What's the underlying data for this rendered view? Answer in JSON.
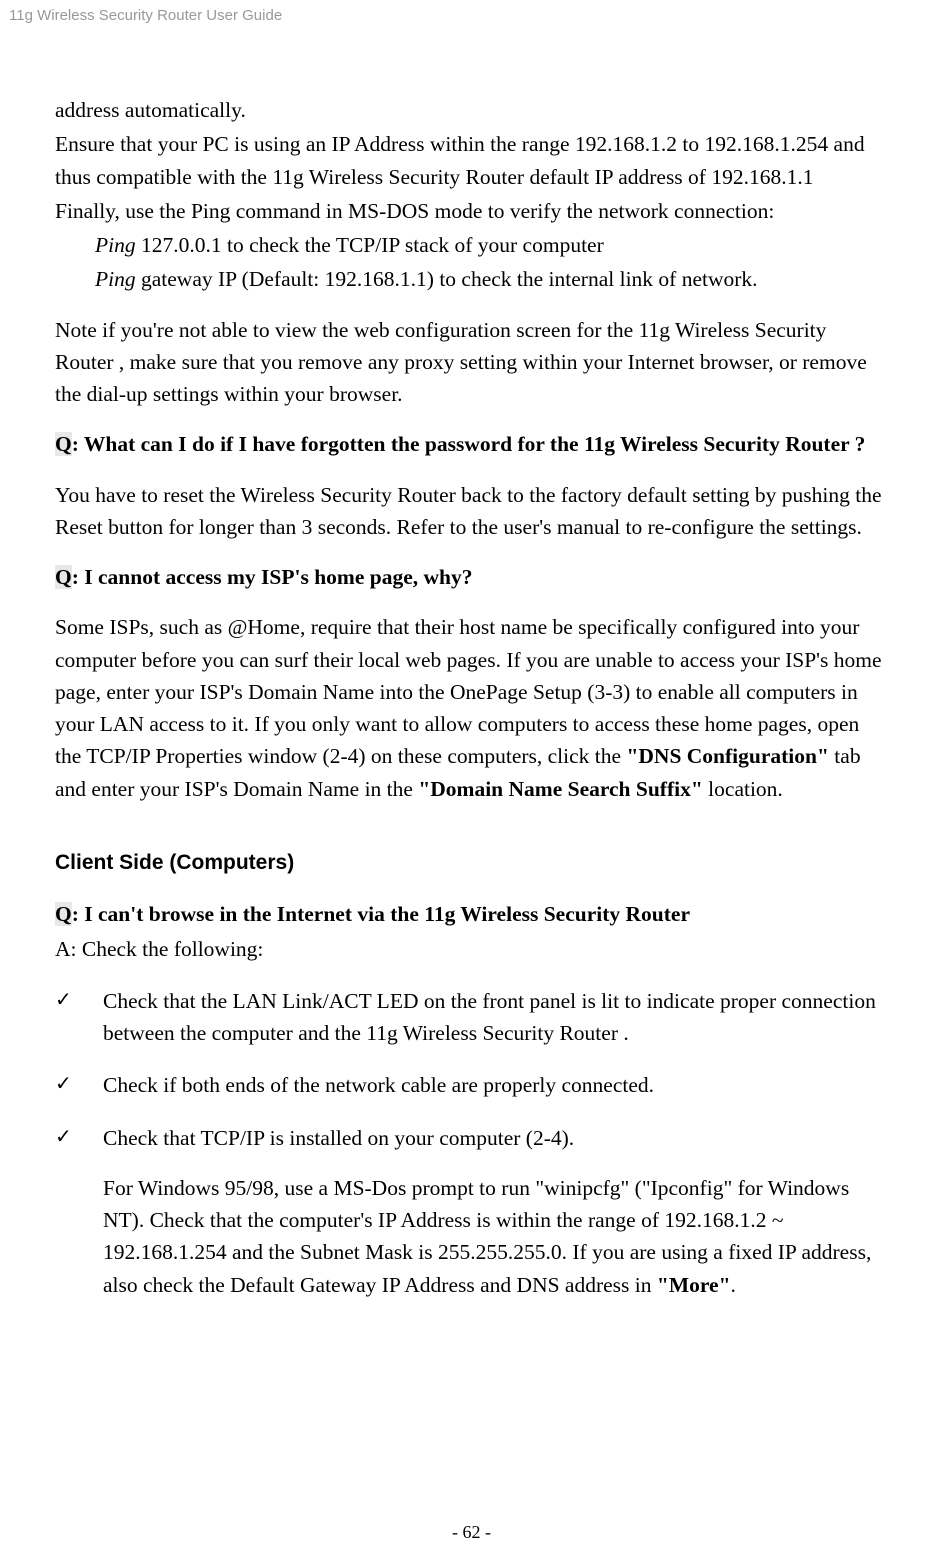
{
  "header": "11g Wireless Security Router User Guide",
  "p1": "address automatically.",
  "p2": "Ensure that your PC is using an IP Address within the range 192.168.1.2 to 192.168.1.254 and thus compatible with the 11g Wireless Security Router  default IP address of 192.168.1.1",
  "p3": "Finally, use the Ping command in MS-DOS mode to verify the network connection:",
  "ping1_prefix": "Ping",
  "ping1_rest": " 127.0.0.1 to check the TCP/IP stack of your computer",
  "ping2_prefix": "Ping",
  "ping2_rest": " gateway IP (Default: 192.168.1.1) to check the internal link of network.",
  "note": "Note if you're not able to view the web configuration screen for the 11g Wireless Security Router , make sure that you remove any proxy setting within your Internet browser, or remove the dial-up settings within your browser.",
  "q1_q": "Q",
  "q1_rest": ": What can I do if I have forgotten the password for the 11g Wireless Security Router ?",
  "a1": "You have to reset the Wireless Security Router back to the factory default setting by pushing the Reset button for longer than 3 seconds. Refer to the user's manual to re-configure the settings.",
  "q2_q": "Q",
  "q2_rest": ": I cannot access my ISP's home page, why?",
  "a2_part1": "Some ISPs, such as @Home, require that their host name be specifically configured into your computer before you can surf their local web pages. If you are unable to access your ISP's home page, enter your ISP's Domain Name into the OnePage Setup (3-3) to enable all computers in your LAN access to it. If you only want to allow computers to access these home pages, open the TCP/IP Properties window (2-4) on these computers, click the ",
  "a2_bold1": "\"DNS Configuration\"",
  "a2_part2": " tab and enter your ISP's Domain Name in the ",
  "a2_bold2": "\"Domain Name Search Suffix\"",
  "a2_part3": " location.",
  "heading": "Client Side (Computers)",
  "q3_q": "Q",
  "q3_rest": ": I can't browse in the Internet via the 11g Wireless Security Router",
  "a3": "A: Check the following:",
  "check1": "Check that the LAN Link/ACT LED on the front panel is lit to indicate proper connection between the computer and the 11g Wireless Security Router .",
  "check2": "Check if both ends of the network cable are properly connected.",
  "check3": "Check that TCP/IP is installed on your computer (2-4).",
  "check3_sub_part1": "For Windows 95/98, use a MS-Dos prompt to run \"winipcfg\" (\"Ipconfig\" for Windows NT). Check that the computer's IP Address is within the range of 192.168.1.2 ~ 192.168.1.254 and the Subnet Mask is 255.255.255.0. If you are using a fixed IP address, also check the Default Gateway IP Address and DNS address in ",
  "check3_sub_bold": "\"More\"",
  "check3_sub_part2": ".",
  "footer": "- 62 -"
}
